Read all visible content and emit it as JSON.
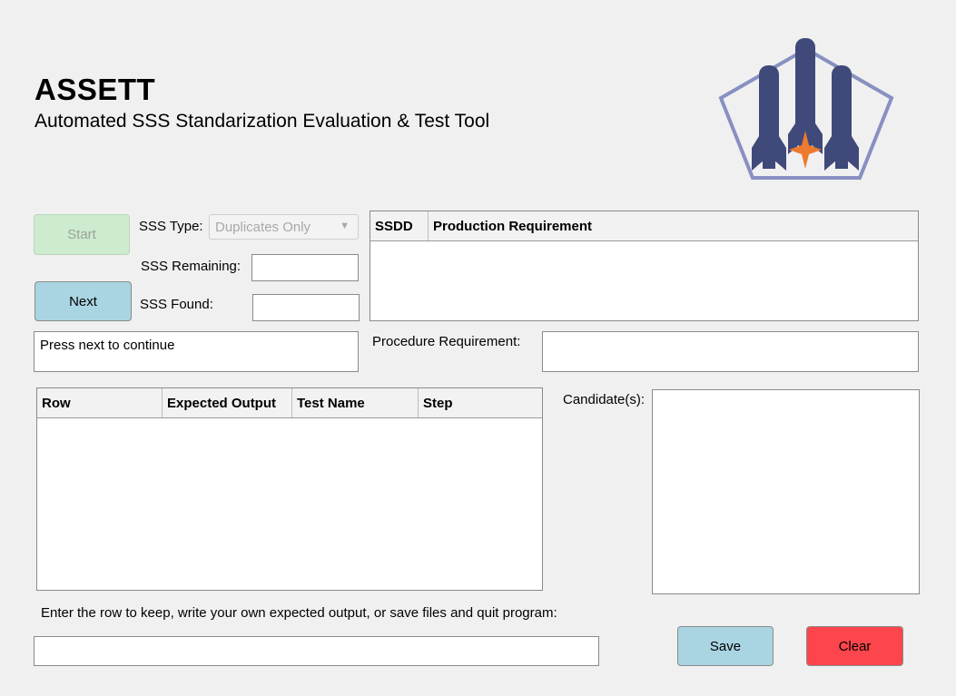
{
  "app": {
    "title": "ASSETT",
    "subtitle": "Automated SSS Standarization Evaluation & Test Tool",
    "logo": "rockets-pentagon-logo"
  },
  "controls": {
    "start_label": "Start",
    "next_label": "Next",
    "sss_type_label": "SSS Type:",
    "sss_type_value": "Duplicates Only",
    "sss_remaining_label": "SSS Remaining:",
    "sss_remaining_value": "",
    "sss_found_label": "SSS Found:",
    "sss_found_value": ""
  },
  "status_message": "Press next to continue",
  "requirement_table": {
    "columns": [
      "SSDD",
      "Production Requirement"
    ],
    "rows": []
  },
  "procedure": {
    "label": "Procedure Requirement:",
    "value": ""
  },
  "output_table": {
    "columns": [
      "Row",
      "Expected Output",
      "Test Name",
      "Step"
    ],
    "rows": []
  },
  "candidates": {
    "label": "Candidate(s):",
    "value": ""
  },
  "bottom": {
    "instruction": "Enter the row to keep, write your own expected output, or save files and quit program:",
    "input_value": "",
    "save_label": "Save",
    "clear_label": "Clear"
  },
  "colors": {
    "start_bg": "#cdebcf",
    "next_bg": "#a9d5e3",
    "save_bg": "#a9d5e3",
    "clear_bg": "#fc454c",
    "logo_navy": "#3f4a7a",
    "logo_outline": "#8790c0",
    "logo_star": "#ec7a2f"
  }
}
